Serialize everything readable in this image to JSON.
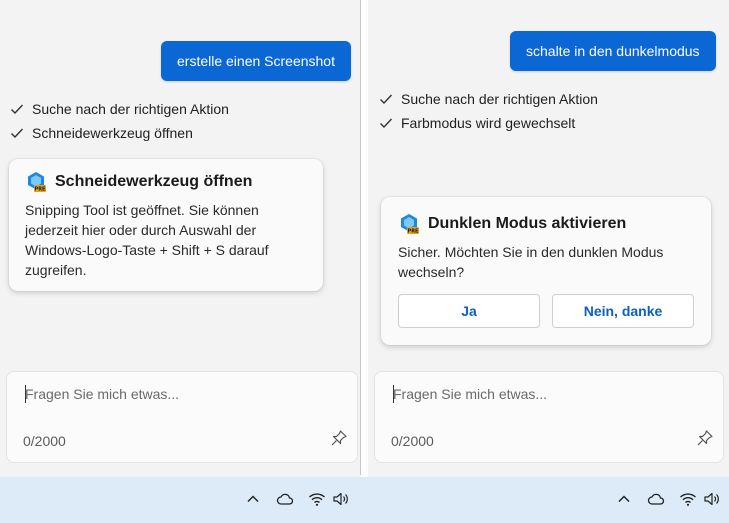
{
  "left": {
    "user_message": "erstelle einen Screenshot",
    "steps": [
      "Suche nach der richtigen Aktion",
      "Schneidewerkzeug öffnen"
    ],
    "card": {
      "icon": "copilot-pre-icon",
      "title": "Schneidewerkzeug öffnen",
      "body": "Snipping Tool ist geöffnet. Sie können jederzeit hier oder durch Auswahl der Windows-Logo-Taste + Shift + S darauf zugreifen."
    },
    "input": {
      "placeholder": "Fragen Sie mich etwas...",
      "counter": "0/2000"
    }
  },
  "right": {
    "user_message": "schalte in den dunkelmodus",
    "steps": [
      "Suche nach der richtigen Aktion",
      "Farbmodus wird gewechselt"
    ],
    "card": {
      "icon": "copilot-pre-icon",
      "title": "Dunklen Modus aktivieren",
      "body": "Sicher. Möchten Sie in den dunklen Modus wechseln?",
      "yes_label": "Ja",
      "no_label": "Nein, danke"
    },
    "input": {
      "placeholder": "Fragen Sie mich etwas...",
      "counter": "0/2000"
    }
  },
  "colors": {
    "accent": "#0a67d3",
    "button_text": "#0b5fbf",
    "taskbar": "#dcebf7"
  },
  "icons": [
    "check-icon",
    "pin-icon",
    "chevron-up-icon",
    "cloud-icon",
    "wifi-icon",
    "speaker-icon"
  ]
}
